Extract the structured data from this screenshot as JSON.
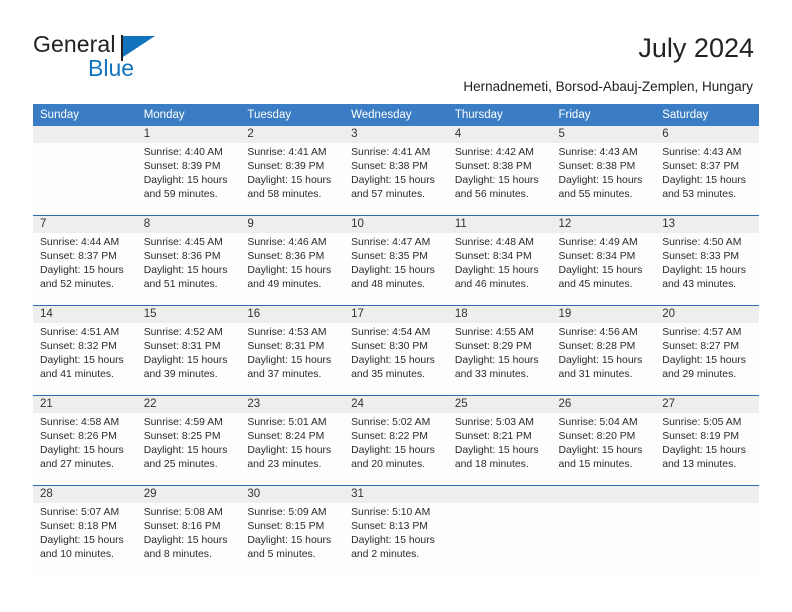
{
  "brand": {
    "name_part1": "General",
    "name_part2": "Blue",
    "flag_icon": "general-blue-flag-logo"
  },
  "header": {
    "title": "July 2024",
    "location": "Hernadnemeti, Borsod-Abauj-Zemplen, Hungary"
  },
  "colors": {
    "header_blue": "#3b7dc4",
    "row_separator_blue": "#2e6cb0",
    "daynum_band_gray": "#eeeeee",
    "brand_blue": "#1273bd",
    "text": "#222222"
  },
  "calendar": {
    "weekday_headers": [
      "Sunday",
      "Monday",
      "Tuesday",
      "Wednesday",
      "Thursday",
      "Friday",
      "Saturday"
    ],
    "weeks": [
      [
        {
          "day": "",
          "empty": true,
          "sunrise": "",
          "sunset": "",
          "daylight_line1": "",
          "daylight_line2": ""
        },
        {
          "day": "1",
          "empty": false,
          "sunrise": "Sunrise: 4:40 AM",
          "sunset": "Sunset: 8:39 PM",
          "daylight_line1": "Daylight: 15 hours",
          "daylight_line2": "and 59 minutes."
        },
        {
          "day": "2",
          "empty": false,
          "sunrise": "Sunrise: 4:41 AM",
          "sunset": "Sunset: 8:39 PM",
          "daylight_line1": "Daylight: 15 hours",
          "daylight_line2": "and 58 minutes."
        },
        {
          "day": "3",
          "empty": false,
          "sunrise": "Sunrise: 4:41 AM",
          "sunset": "Sunset: 8:38 PM",
          "daylight_line1": "Daylight: 15 hours",
          "daylight_line2": "and 57 minutes."
        },
        {
          "day": "4",
          "empty": false,
          "sunrise": "Sunrise: 4:42 AM",
          "sunset": "Sunset: 8:38 PM",
          "daylight_line1": "Daylight: 15 hours",
          "daylight_line2": "and 56 minutes."
        },
        {
          "day": "5",
          "empty": false,
          "sunrise": "Sunrise: 4:43 AM",
          "sunset": "Sunset: 8:38 PM",
          "daylight_line1": "Daylight: 15 hours",
          "daylight_line2": "and 55 minutes."
        },
        {
          "day": "6",
          "empty": false,
          "sunrise": "Sunrise: 4:43 AM",
          "sunset": "Sunset: 8:37 PM",
          "daylight_line1": "Daylight: 15 hours",
          "daylight_line2": "and 53 minutes."
        }
      ],
      [
        {
          "day": "7",
          "empty": false,
          "sunrise": "Sunrise: 4:44 AM",
          "sunset": "Sunset: 8:37 PM",
          "daylight_line1": "Daylight: 15 hours",
          "daylight_line2": "and 52 minutes."
        },
        {
          "day": "8",
          "empty": false,
          "sunrise": "Sunrise: 4:45 AM",
          "sunset": "Sunset: 8:36 PM",
          "daylight_line1": "Daylight: 15 hours",
          "daylight_line2": "and 51 minutes."
        },
        {
          "day": "9",
          "empty": false,
          "sunrise": "Sunrise: 4:46 AM",
          "sunset": "Sunset: 8:36 PM",
          "daylight_line1": "Daylight: 15 hours",
          "daylight_line2": "and 49 minutes."
        },
        {
          "day": "10",
          "empty": false,
          "sunrise": "Sunrise: 4:47 AM",
          "sunset": "Sunset: 8:35 PM",
          "daylight_line1": "Daylight: 15 hours",
          "daylight_line2": "and 48 minutes."
        },
        {
          "day": "11",
          "empty": false,
          "sunrise": "Sunrise: 4:48 AM",
          "sunset": "Sunset: 8:34 PM",
          "daylight_line1": "Daylight: 15 hours",
          "daylight_line2": "and 46 minutes."
        },
        {
          "day": "12",
          "empty": false,
          "sunrise": "Sunrise: 4:49 AM",
          "sunset": "Sunset: 8:34 PM",
          "daylight_line1": "Daylight: 15 hours",
          "daylight_line2": "and 45 minutes."
        },
        {
          "day": "13",
          "empty": false,
          "sunrise": "Sunrise: 4:50 AM",
          "sunset": "Sunset: 8:33 PM",
          "daylight_line1": "Daylight: 15 hours",
          "daylight_line2": "and 43 minutes."
        }
      ],
      [
        {
          "day": "14",
          "empty": false,
          "sunrise": "Sunrise: 4:51 AM",
          "sunset": "Sunset: 8:32 PM",
          "daylight_line1": "Daylight: 15 hours",
          "daylight_line2": "and 41 minutes."
        },
        {
          "day": "15",
          "empty": false,
          "sunrise": "Sunrise: 4:52 AM",
          "sunset": "Sunset: 8:31 PM",
          "daylight_line1": "Daylight: 15 hours",
          "daylight_line2": "and 39 minutes."
        },
        {
          "day": "16",
          "empty": false,
          "sunrise": "Sunrise: 4:53 AM",
          "sunset": "Sunset: 8:31 PM",
          "daylight_line1": "Daylight: 15 hours",
          "daylight_line2": "and 37 minutes."
        },
        {
          "day": "17",
          "empty": false,
          "sunrise": "Sunrise: 4:54 AM",
          "sunset": "Sunset: 8:30 PM",
          "daylight_line1": "Daylight: 15 hours",
          "daylight_line2": "and 35 minutes."
        },
        {
          "day": "18",
          "empty": false,
          "sunrise": "Sunrise: 4:55 AM",
          "sunset": "Sunset: 8:29 PM",
          "daylight_line1": "Daylight: 15 hours",
          "daylight_line2": "and 33 minutes."
        },
        {
          "day": "19",
          "empty": false,
          "sunrise": "Sunrise: 4:56 AM",
          "sunset": "Sunset: 8:28 PM",
          "daylight_line1": "Daylight: 15 hours",
          "daylight_line2": "and 31 minutes."
        },
        {
          "day": "20",
          "empty": false,
          "sunrise": "Sunrise: 4:57 AM",
          "sunset": "Sunset: 8:27 PM",
          "daylight_line1": "Daylight: 15 hours",
          "daylight_line2": "and 29 minutes."
        }
      ],
      [
        {
          "day": "21",
          "empty": false,
          "sunrise": "Sunrise: 4:58 AM",
          "sunset": "Sunset: 8:26 PM",
          "daylight_line1": "Daylight: 15 hours",
          "daylight_line2": "and 27 minutes."
        },
        {
          "day": "22",
          "empty": false,
          "sunrise": "Sunrise: 4:59 AM",
          "sunset": "Sunset: 8:25 PM",
          "daylight_line1": "Daylight: 15 hours",
          "daylight_line2": "and 25 minutes."
        },
        {
          "day": "23",
          "empty": false,
          "sunrise": "Sunrise: 5:01 AM",
          "sunset": "Sunset: 8:24 PM",
          "daylight_line1": "Daylight: 15 hours",
          "daylight_line2": "and 23 minutes."
        },
        {
          "day": "24",
          "empty": false,
          "sunrise": "Sunrise: 5:02 AM",
          "sunset": "Sunset: 8:22 PM",
          "daylight_line1": "Daylight: 15 hours",
          "daylight_line2": "and 20 minutes."
        },
        {
          "day": "25",
          "empty": false,
          "sunrise": "Sunrise: 5:03 AM",
          "sunset": "Sunset: 8:21 PM",
          "daylight_line1": "Daylight: 15 hours",
          "daylight_line2": "and 18 minutes."
        },
        {
          "day": "26",
          "empty": false,
          "sunrise": "Sunrise: 5:04 AM",
          "sunset": "Sunset: 8:20 PM",
          "daylight_line1": "Daylight: 15 hours",
          "daylight_line2": "and 15 minutes."
        },
        {
          "day": "27",
          "empty": false,
          "sunrise": "Sunrise: 5:05 AM",
          "sunset": "Sunset: 8:19 PM",
          "daylight_line1": "Daylight: 15 hours",
          "daylight_line2": "and 13 minutes."
        }
      ],
      [
        {
          "day": "28",
          "empty": false,
          "sunrise": "Sunrise: 5:07 AM",
          "sunset": "Sunset: 8:18 PM",
          "daylight_line1": "Daylight: 15 hours",
          "daylight_line2": "and 10 minutes."
        },
        {
          "day": "29",
          "empty": false,
          "sunrise": "Sunrise: 5:08 AM",
          "sunset": "Sunset: 8:16 PM",
          "daylight_line1": "Daylight: 15 hours",
          "daylight_line2": "and 8 minutes."
        },
        {
          "day": "30",
          "empty": false,
          "sunrise": "Sunrise: 5:09 AM",
          "sunset": "Sunset: 8:15 PM",
          "daylight_line1": "Daylight: 15 hours",
          "daylight_line2": "and 5 minutes."
        },
        {
          "day": "31",
          "empty": false,
          "sunrise": "Sunrise: 5:10 AM",
          "sunset": "Sunset: 8:13 PM",
          "daylight_line1": "Daylight: 15 hours",
          "daylight_line2": "and 2 minutes."
        },
        {
          "day": "",
          "empty": true,
          "sunrise": "",
          "sunset": "",
          "daylight_line1": "",
          "daylight_line2": ""
        },
        {
          "day": "",
          "empty": true,
          "sunrise": "",
          "sunset": "",
          "daylight_line1": "",
          "daylight_line2": ""
        },
        {
          "day": "",
          "empty": true,
          "sunrise": "",
          "sunset": "",
          "daylight_line1": "",
          "daylight_line2": ""
        }
      ]
    ]
  }
}
